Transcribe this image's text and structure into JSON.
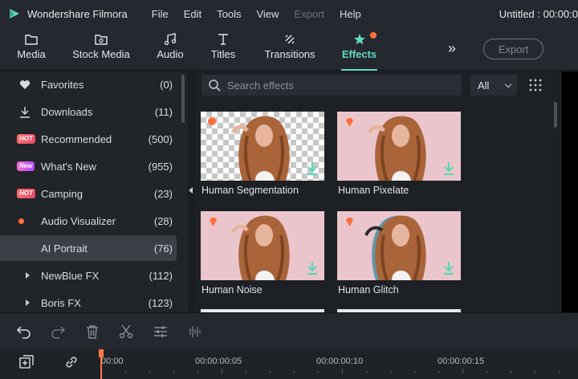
{
  "app": {
    "name": "Wondershare Filmora",
    "doc_title": "Untitled : 00:00:0"
  },
  "menu": [
    {
      "label": "File",
      "disabled": false
    },
    {
      "label": "Edit",
      "disabled": false
    },
    {
      "label": "Tools",
      "disabled": false
    },
    {
      "label": "View",
      "disabled": false
    },
    {
      "label": "Export",
      "disabled": true
    },
    {
      "label": "Help",
      "disabled": false
    }
  ],
  "tabs": [
    {
      "label": "Media",
      "icon": "folder-icon"
    },
    {
      "label": "Stock Media",
      "icon": "stock-media-icon"
    },
    {
      "label": "Audio",
      "icon": "music-note-icon"
    },
    {
      "label": "Titles",
      "icon": "text-t-icon"
    },
    {
      "label": "Transitions",
      "icon": "transitions-icon"
    },
    {
      "label": "Effects",
      "icon": "effects-star-icon",
      "active": true
    }
  ],
  "toolbar": {
    "more": "»",
    "export_label": "Export"
  },
  "sidebar": {
    "items": [
      {
        "label": "Favorites",
        "count": "(0)",
        "icon": "heart-icon"
      },
      {
        "label": "Downloads",
        "count": "(11)",
        "icon": "download-icon"
      },
      {
        "label": "Recommended",
        "count": "(500)",
        "badge": "HOT"
      },
      {
        "label": "What's New",
        "count": "(955)",
        "badge": "New"
      },
      {
        "label": "Camping",
        "count": "(23)",
        "badge": "HOT"
      },
      {
        "label": "Audio Visualizer",
        "count": "(28)",
        "icon": "dot-icon"
      },
      {
        "label": "AI Portrait",
        "count": "(76)",
        "active": true
      },
      {
        "label": "NewBlue FX",
        "count": "(112)",
        "icon": "caret-right-icon"
      },
      {
        "label": "Boris FX",
        "count": "(123)",
        "icon": "caret-right-icon"
      }
    ]
  },
  "effects": {
    "search_placeholder": "Search effects",
    "filter_value": "All",
    "cards": [
      {
        "label": "Human Segmentation"
      },
      {
        "label": "Human Pixelate"
      },
      {
        "label": "Human Noise"
      },
      {
        "label": "Human Glitch"
      }
    ]
  },
  "timeline": {
    "ticks": [
      "00:00",
      "00:00:00:05",
      "00:00:00:10",
      "00:00:00:15"
    ]
  },
  "colors": {
    "accent": "#62d9c4",
    "hot": "#e84a6d",
    "gem": "#ff6f3c"
  }
}
